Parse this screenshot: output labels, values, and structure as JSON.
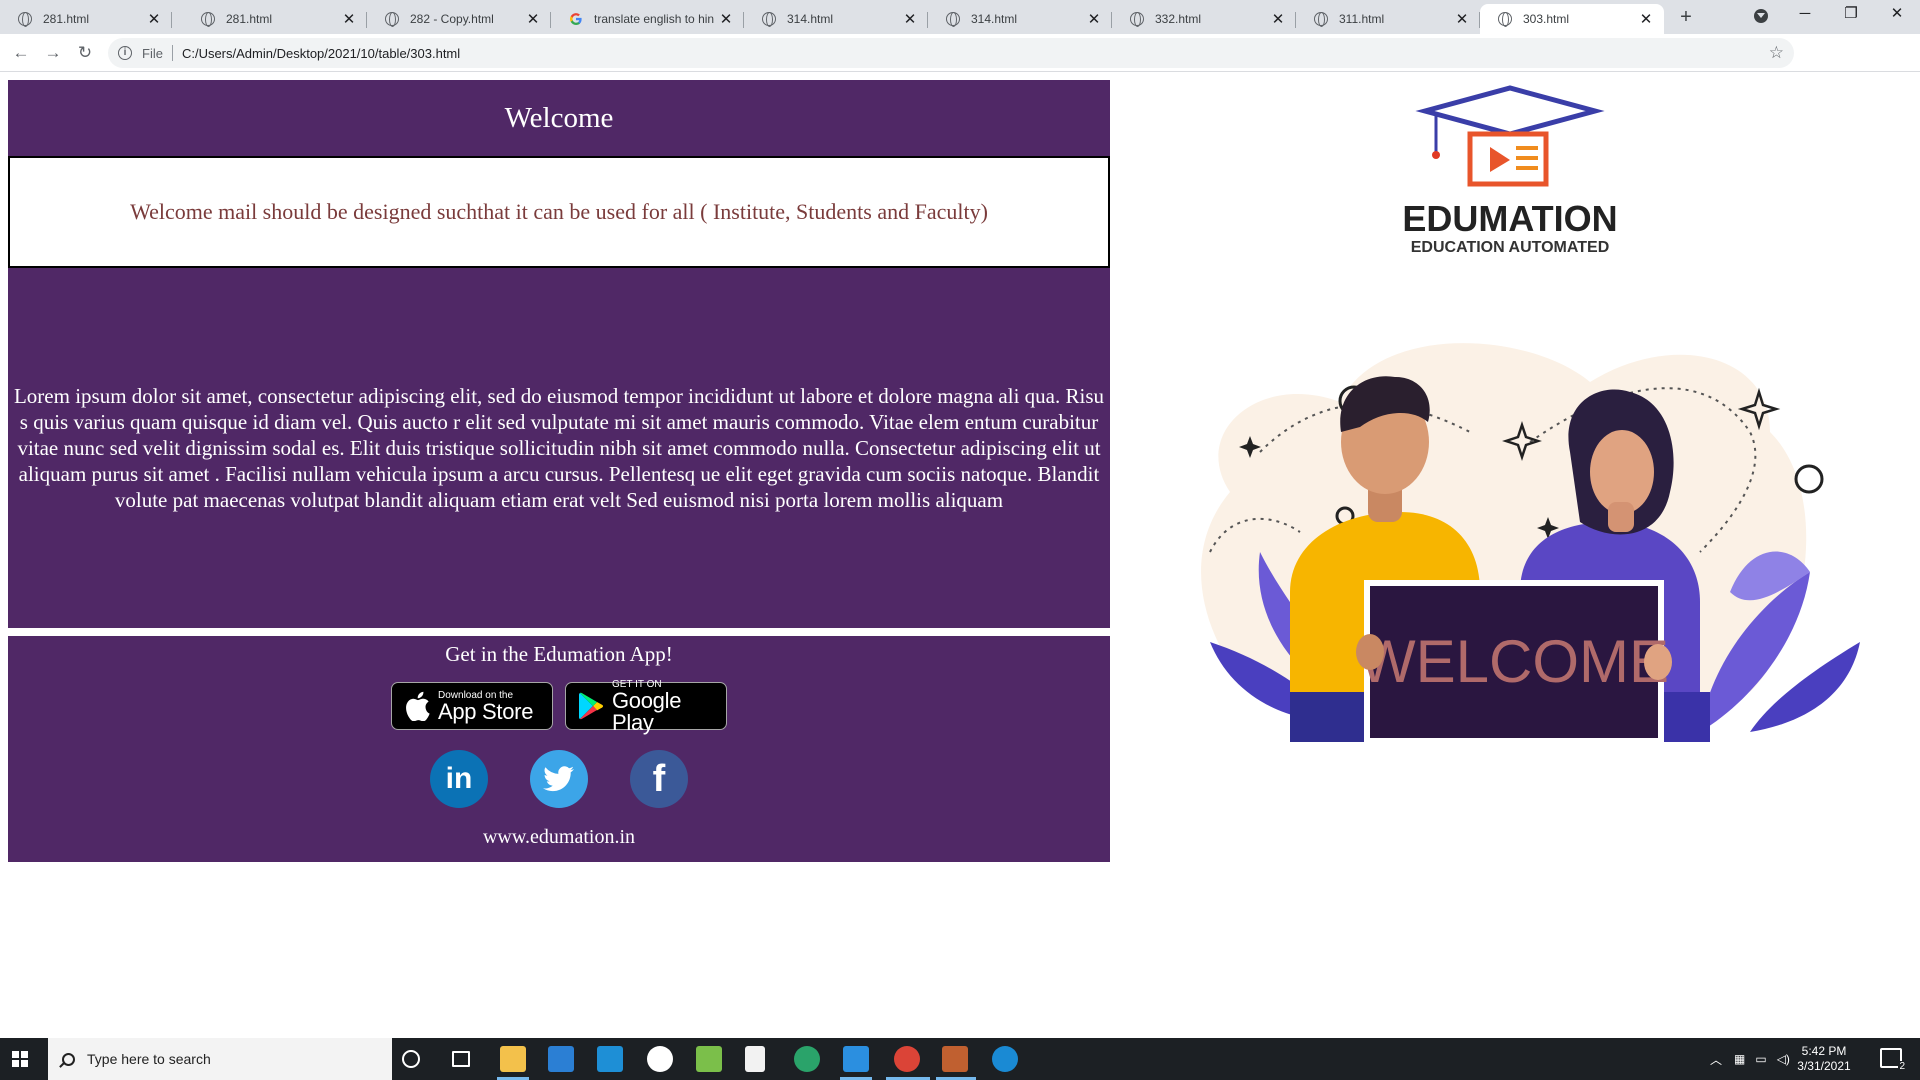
{
  "browser": {
    "tabs": [
      {
        "title": "281.html",
        "icon": "globe-icon"
      },
      {
        "title": "281.html",
        "icon": "globe-icon"
      },
      {
        "title": "282 - Copy.html",
        "icon": "globe-icon"
      },
      {
        "title": "translate english to hin",
        "icon": "google-icon"
      },
      {
        "title": "314.html",
        "icon": "globe-icon"
      },
      {
        "title": "314.html",
        "icon": "globe-icon"
      },
      {
        "title": "332.html",
        "icon": "globe-icon"
      },
      {
        "title": "311.html",
        "icon": "globe-icon"
      },
      {
        "title": "303.html",
        "icon": "globe-icon",
        "active": true
      }
    ],
    "address": {
      "scheme_label": "File",
      "url": "C:/Users/Admin/Desktop/2021/10/table/303.html"
    }
  },
  "page": {
    "header_title": "Welcome",
    "notice": "Welcome mail should be designed suchthat it can be used for all ( Institute, Students and Faculty)",
    "body_text": "Lorem ipsum dolor sit amet, consectetur adipiscing elit, sed do eiusmod tempor incididunt ut labore et dolore magna ali qua. Risus quis varius quam quisque id diam vel. Quis aucto r elit sed vulputate mi sit amet mauris commodo. Vitae elem entum curabitur vitae nunc sed velit dignissim sodal es. Elit duis tristique sollicitudin nibh sit amet commodo nulla. Consectetur adipiscing elit ut aliquam purus sit amet . Facilisi nullam vehicula ipsum a arcu cursus. Pellentesq ue elit eget gravida cum sociis natoque. Blandit volute pat maecenas volutpat blandit aliquam etiam erat velt Sed euismod nisi porta lorem mollis aliquam",
    "footer": {
      "heading": "Get in the Edumation App!",
      "app_store": {
        "small": "Download on the",
        "big": "App Store"
      },
      "google_play": {
        "small": "GET IT ON",
        "big": "Google Play"
      },
      "social": {
        "linkedin": "in",
        "facebook": "f"
      },
      "website": "www.edumation.in"
    },
    "brand": {
      "name": "EDUMATION",
      "tagline": "EDUCATION AUTOMATED"
    },
    "illustration_sign": "WELCOME",
    "colors": {
      "panel": "#502866",
      "notice_text": "#7a3b3b",
      "sign_bg": "#2a1640",
      "sign_text": "#b06a6a"
    }
  },
  "taskbar": {
    "search_placeholder": "Type here to search",
    "time": "5:42 PM",
    "date": "3/31/2021",
    "notification_count": "2"
  }
}
